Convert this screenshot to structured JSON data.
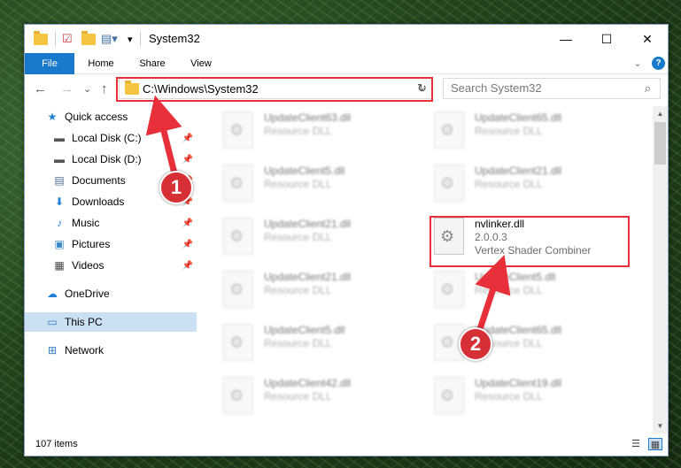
{
  "window": {
    "title": "System32",
    "controls": {
      "minimize": "—",
      "maximize": "☐",
      "close": "✕"
    }
  },
  "ribbon": {
    "tabs": [
      "File",
      "Home",
      "Share",
      "View"
    ],
    "collapse": "⌄",
    "help": "?"
  },
  "nav": {
    "back": "←",
    "forward": "→",
    "recent": "⌄",
    "up": "↑",
    "address": "C:\\Windows\\System32",
    "refresh": "↻",
    "search_placeholder": "Search System32"
  },
  "sidebar": {
    "items": [
      {
        "label": "Quick access",
        "icon": "star-icon",
        "glyph": "★",
        "color": "#1e7fd6",
        "pinned": false
      },
      {
        "label": "Local Disk (C:)",
        "icon": "drive-icon",
        "glyph": "▬",
        "color": "#555555",
        "pinned": true
      },
      {
        "label": "Local Disk (D:)",
        "icon": "drive-icon",
        "glyph": "▬",
        "color": "#555555",
        "pinned": true
      },
      {
        "label": "Documents",
        "icon": "document-icon",
        "glyph": "▤",
        "color": "#4d6c90",
        "pinned": true
      },
      {
        "label": "Downloads",
        "icon": "download-icon",
        "glyph": "⬇",
        "color": "#1e7fd6",
        "pinned": true
      },
      {
        "label": "Music",
        "icon": "music-icon",
        "glyph": "♪",
        "color": "#1e7fd6",
        "pinned": true
      },
      {
        "label": "Pictures",
        "icon": "picture-icon",
        "glyph": "▣",
        "color": "#3d88c7",
        "pinned": true
      },
      {
        "label": "Videos",
        "icon": "video-icon",
        "glyph": "▦",
        "color": "#444444",
        "pinned": true
      },
      {
        "label": "OneDrive",
        "icon": "cloud-icon",
        "glyph": "☁",
        "color": "#1e7fd6",
        "pinned": false
      },
      {
        "label": "This PC",
        "icon": "computer-icon",
        "glyph": "▭",
        "color": "#2a7ac4",
        "pinned": false
      },
      {
        "label": "Network",
        "icon": "network-icon",
        "glyph": "⊞",
        "color": "#2a7ac4",
        "pinned": false
      }
    ],
    "pin_glyph": "📌"
  },
  "files": [
    {
      "name": "UpdateClient63.dll",
      "line2": "Resource DLL",
      "line3": "",
      "blurred": true
    },
    {
      "name": "UpdateClient65.dll",
      "line2": "Resource DLL",
      "line3": "",
      "blurred": true
    },
    {
      "name": "UpdateClient5.dll",
      "line2": "Resource DLL",
      "line3": "",
      "blurred": true
    },
    {
      "name": "UpdateClient21.dll",
      "line2": "Resource DLL",
      "line3": "",
      "blurred": true
    },
    {
      "name": "UpdateClient21.dll",
      "line2": "Resource DLL",
      "line3": "",
      "blurred": true
    },
    {
      "name": "nvlinker.dll",
      "line2": "2.0.0.3",
      "line3": "Vertex Shader Combiner",
      "blurred": false
    },
    {
      "name": "UpdateClient21.dll",
      "line2": "Resource DLL",
      "line3": "",
      "blurred": true
    },
    {
      "name": "UpdateClient5.dll",
      "line2": "Resource DLL",
      "line3": "",
      "blurred": true
    },
    {
      "name": "UpdateClient5.dll",
      "line2": "Resource DLL",
      "line3": "",
      "blurred": true
    },
    {
      "name": "UpdateClient65.dll",
      "line2": "Resource DLL",
      "line3": "",
      "blurred": true
    },
    {
      "name": "UpdateClient42.dll",
      "line2": "Resource DLL",
      "line3": "",
      "blurred": true
    },
    {
      "name": "UpdateClient19.dll",
      "line2": "Resource DLL",
      "line3": "",
      "blurred": true
    }
  ],
  "status": {
    "count": "107 items",
    "details_view": "☰",
    "tiles_view": "▦"
  },
  "annotations": {
    "callout_1": "1",
    "callout_2": "2",
    "color": "#e8303a"
  }
}
